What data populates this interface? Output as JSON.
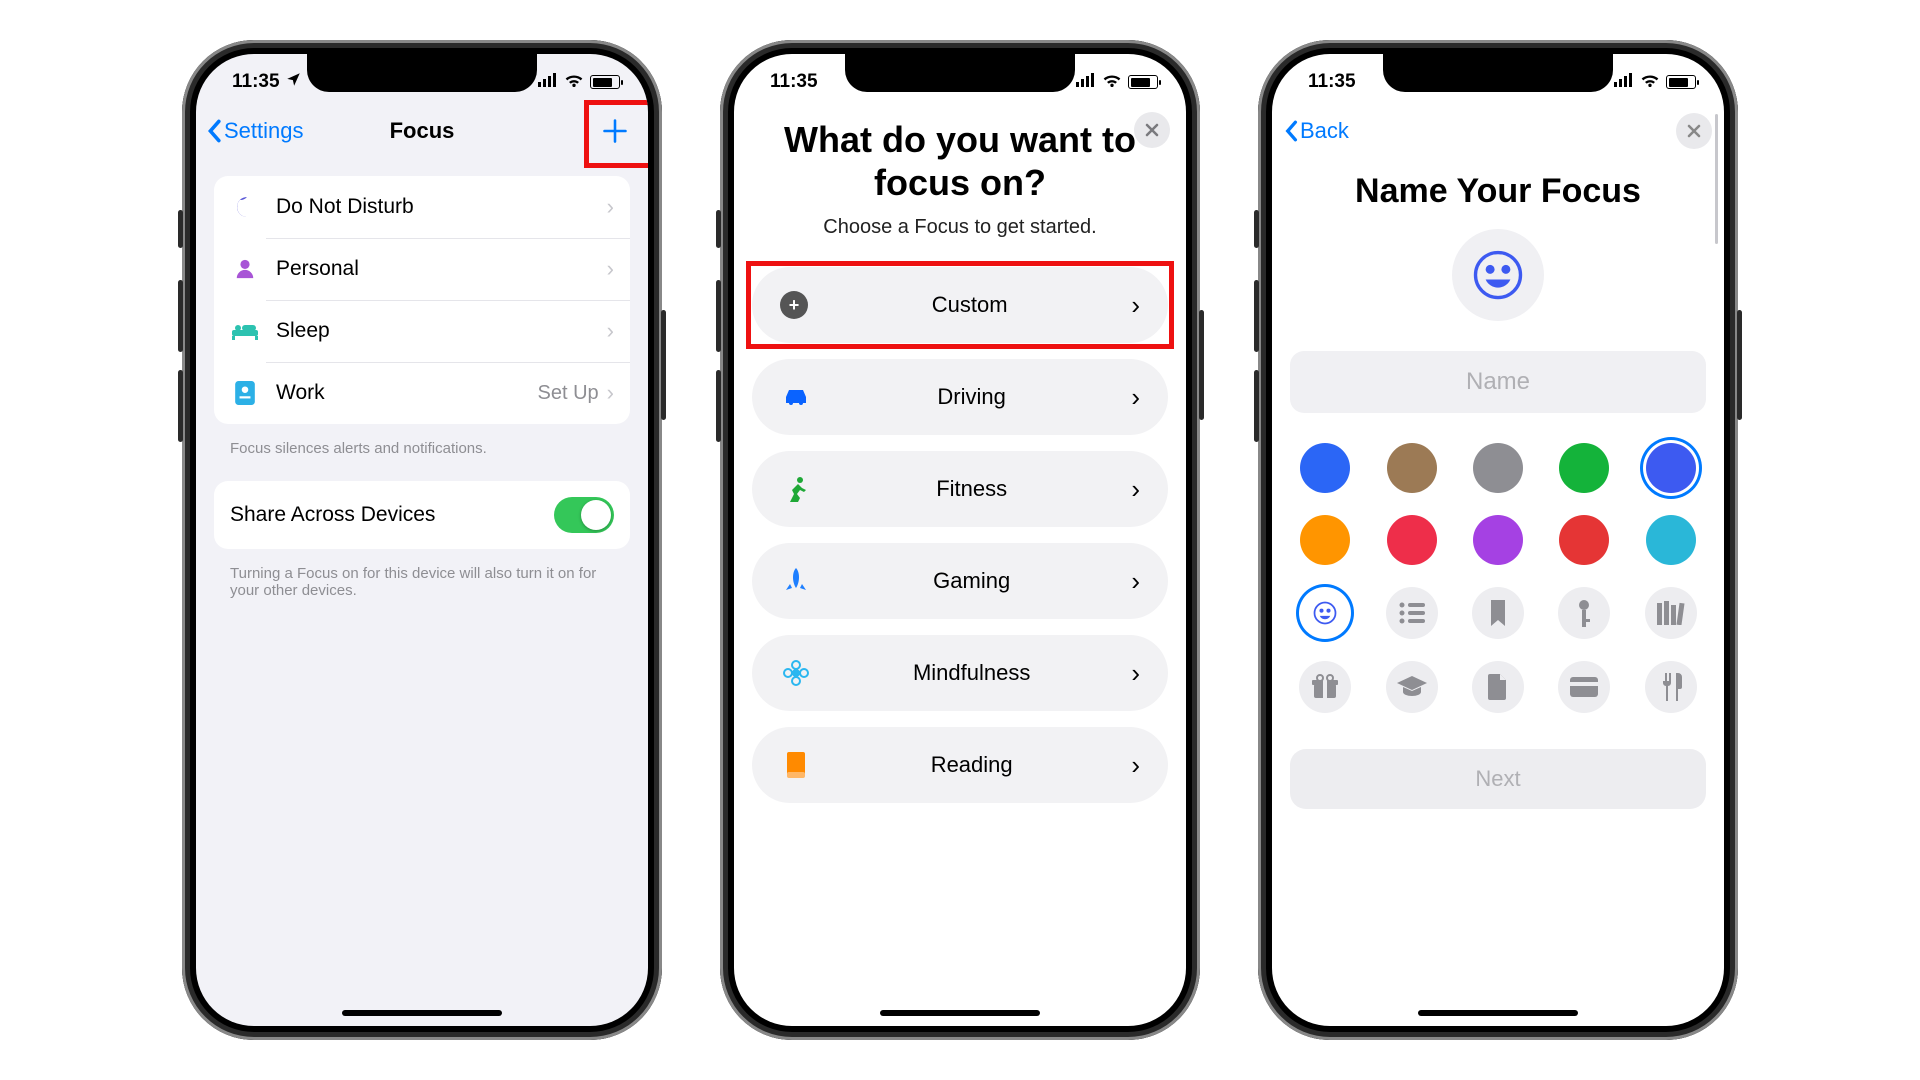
{
  "status": {
    "time": "11:35",
    "location_icon": "location",
    "signal": "signal",
    "wifi": "wifi"
  },
  "screen1": {
    "back_label": "Settings",
    "title": "Focus",
    "rows": [
      {
        "icon": "moon",
        "color": "#5856d6",
        "label": "Do Not Disturb"
      },
      {
        "icon": "person",
        "color": "#a855d6",
        "label": "Personal"
      },
      {
        "icon": "bed",
        "color": "#2cc2b0",
        "label": "Sleep"
      },
      {
        "icon": "badge",
        "color": "#2cb0e6",
        "label": "Work",
        "trail": "Set Up"
      }
    ],
    "footnote1": "Focus silences alerts and notifications.",
    "share_label": "Share Across Devices",
    "share_footnote": "Turning a Focus on for this device will also turn it on for your other devices."
  },
  "screen2": {
    "heading": "What do you want to focus on?",
    "subheading": "Choose a Focus to get started.",
    "options": [
      {
        "key": "custom",
        "label": "Custom",
        "icon": "plus",
        "color": "#555"
      },
      {
        "key": "driving",
        "label": "Driving",
        "icon": "car",
        "color": "#0a63ff"
      },
      {
        "key": "fitness",
        "label": "Fitness",
        "icon": "runner",
        "color": "#1fa836"
      },
      {
        "key": "gaming",
        "label": "Gaming",
        "icon": "rocket",
        "color": "#1e7fff"
      },
      {
        "key": "mindfulness",
        "label": "Mindfulness",
        "icon": "flower",
        "color": "#2bb7f0"
      },
      {
        "key": "reading",
        "label": "Reading",
        "icon": "book",
        "color": "#ff8a00"
      }
    ]
  },
  "screen3": {
    "back_label": "Back",
    "heading": "Name Your Focus",
    "name_placeholder": "Name",
    "colors": [
      "#2b66f6",
      "#9c7a55",
      "#8e8e93",
      "#14b33a",
      "#3d5af1",
      "#ff9500",
      "#ee2e4a",
      "#a541e3",
      "#e53535",
      "#2ab7d8"
    ],
    "selected_color_index": 4,
    "icons": [
      "smile",
      "list",
      "bookmark",
      "key",
      "library",
      "gift",
      "gradcap",
      "file",
      "card",
      "utensils"
    ],
    "selected_icon_index": 0,
    "next_label": "Next"
  }
}
